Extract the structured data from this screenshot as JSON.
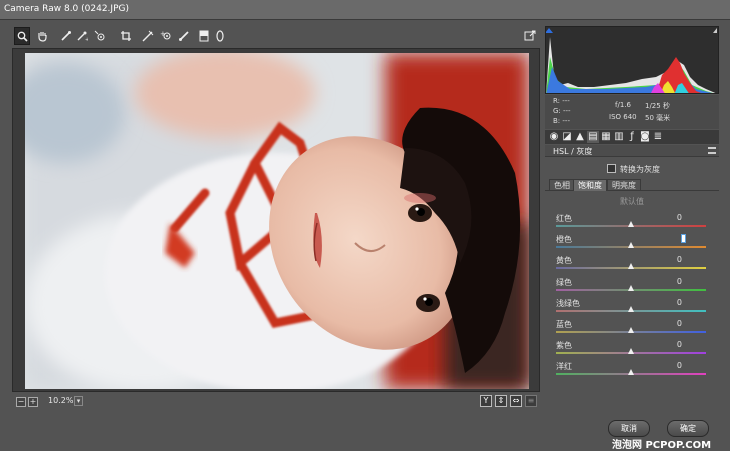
{
  "window": {
    "title": "Camera Raw 8.0 (0242.JPG)"
  },
  "toolbar": {
    "tools": [
      {
        "name": "zoom-tool-icon",
        "glyph": "🔍"
      },
      {
        "name": "hand-tool-icon",
        "glyph": "✋"
      },
      {
        "name": "white-balance-tool-icon",
        "glyph": "✎"
      },
      {
        "name": "color-sampler-tool-icon",
        "glyph": "✎"
      },
      {
        "name": "targeted-adjustment-tool-icon",
        "glyph": "◎"
      },
      {
        "name": "crop-tool-icon",
        "glyph": "⌐"
      },
      {
        "name": "straighten-tool-icon",
        "glyph": "⟋"
      },
      {
        "name": "red-eye-tool-icon",
        "glyph": "◉"
      },
      {
        "name": "adjustment-brush-icon",
        "glyph": "⟋"
      },
      {
        "name": "graduated-filter-icon",
        "glyph": "▮"
      },
      {
        "name": "radial-filter-icon",
        "glyph": "○"
      }
    ],
    "fullscreen_icon": "fullscreen-icon"
  },
  "zoom": {
    "value": "10.2%"
  },
  "view_buttons": [
    "Y"
  ],
  "readout": {
    "r": "R: ---",
    "g": "G: ---",
    "b": "B: ---",
    "aperture": "f/1.6",
    "shutter": "1/25 秒",
    "iso": "ISO 640",
    "focal": "50 毫米"
  },
  "panel": {
    "title": "HSL / 灰度",
    "convert_grayscale": "转换为灰度",
    "subtabs": [
      "色相",
      "饱和度",
      "明亮度"
    ],
    "active_subtab": 1,
    "default_label": "默认值",
    "sliders": [
      {
        "label": "红色",
        "value": "0",
        "position": 0.5
      },
      {
        "label": "橙色",
        "value": "",
        "position": 0.5
      },
      {
        "label": "黄色",
        "value": "0",
        "position": 0.5
      },
      {
        "label": "绿色",
        "value": "0",
        "position": 0.5
      },
      {
        "label": "浅绿色",
        "value": "0",
        "position": 0.5
      },
      {
        "label": "蓝色",
        "value": "0",
        "position": 0.5
      },
      {
        "label": "紫色",
        "value": "0",
        "position": 0.5
      },
      {
        "label": "洋红",
        "value": "0",
        "position": 0.5
      }
    ]
  },
  "buttons": {
    "cancel": "取消",
    "ok": "确定"
  },
  "watermark": "泡泡网 PCPOP.COM",
  "colors": {
    "accent": "#5aa0e0",
    "red": "#c8321e"
  }
}
